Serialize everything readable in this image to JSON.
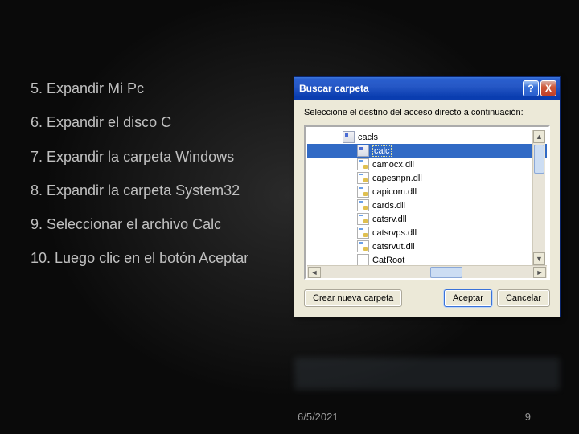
{
  "instructions": [
    "5. Expandir Mi Pc",
    "6. Expandir  el disco C",
    "7. Expandir  la  carpeta Windows",
    "8. Expandir  la carpeta System32",
    "9. Seleccionar el archivo Calc",
    "10. Luego  clic  en  el botón Aceptar"
  ],
  "dialog": {
    "title": "Buscar carpeta",
    "help_symbol": "?",
    "close_symbol": "X",
    "prompt": "Seleccione el destino del acceso directo a continuación:",
    "files": [
      {
        "name": "cacls",
        "type": "exe",
        "selected": false,
        "first": true
      },
      {
        "name": "calc",
        "type": "exe",
        "selected": true
      },
      {
        "name": "camocx.dll",
        "type": "dll",
        "selected": false
      },
      {
        "name": "capesnpn.dll",
        "type": "dll",
        "selected": false
      },
      {
        "name": "capicom.dll",
        "type": "dll",
        "selected": false
      },
      {
        "name": "cards.dll",
        "type": "dll",
        "selected": false
      },
      {
        "name": "catsrv.dll",
        "type": "dll",
        "selected": false
      },
      {
        "name": "catsrvps.dll",
        "type": "dll",
        "selected": false
      },
      {
        "name": "catsrvut.dll",
        "type": "dll",
        "selected": false
      },
      {
        "name": "CatRoot",
        "type": "folder",
        "selected": false
      }
    ],
    "buttons": {
      "new_folder": "Crear nueva carpeta",
      "accept": "Aceptar",
      "cancel": "Cancelar"
    }
  },
  "footer": {
    "date": "6/5/2021",
    "page": "9"
  }
}
